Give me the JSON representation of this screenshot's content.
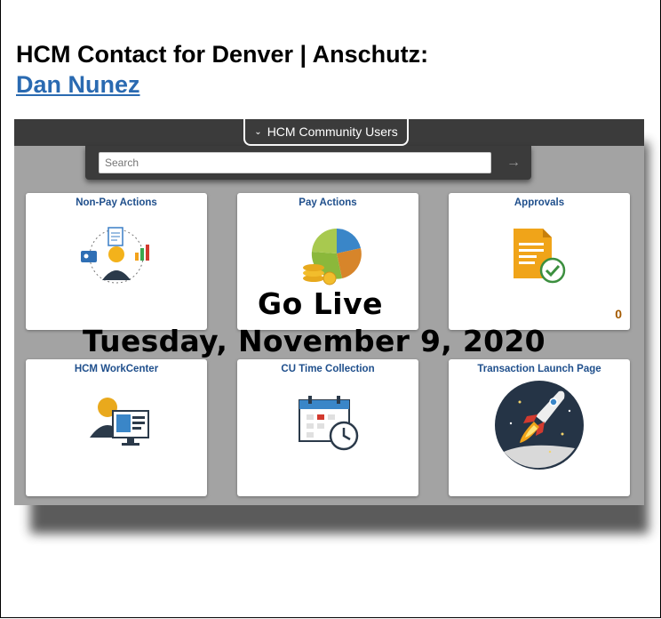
{
  "contact": {
    "heading": "HCM Contact for Denver | Anschutz:",
    "name_link": "Dan Nunez"
  },
  "homepage": {
    "selector_label": "HCM Community Users",
    "search_placeholder": "Search"
  },
  "tiles": [
    {
      "title": "Non-Pay Actions",
      "icon": "people-actions-icon"
    },
    {
      "title": "Pay Actions",
      "icon": "pie-coins-icon"
    },
    {
      "title": "Approvals",
      "icon": "document-check-icon",
      "count": "0"
    },
    {
      "title": "HCM WorkCenter",
      "icon": "person-monitor-icon"
    },
    {
      "title": "CU Time Collection",
      "icon": "calendar-clock-icon"
    },
    {
      "title": "Transaction Launch Page",
      "icon": "rocket-icon"
    }
  ],
  "overlay": {
    "line1": "Go Live",
    "line2": "Tuesday, November 9, 2020"
  },
  "colors": {
    "link": "#2a6ab1",
    "tile_title": "#1f4f8c",
    "topbar": "#3b3b3b",
    "background": "#a3a3a3",
    "count": "#a35a00"
  }
}
